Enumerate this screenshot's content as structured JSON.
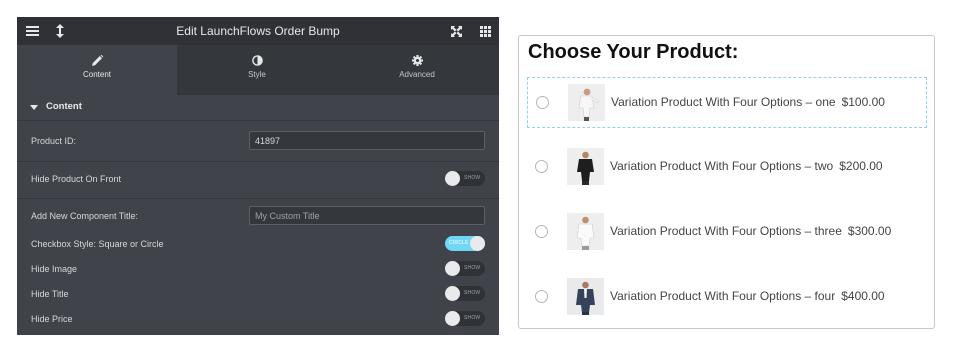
{
  "editor": {
    "title": "Edit LaunchFlows Order Bump",
    "tabs": [
      {
        "label": "Content",
        "icon": "pencil-icon",
        "active": true
      },
      {
        "label": "Style",
        "icon": "contrast-icon",
        "active": false
      },
      {
        "label": "Advanced",
        "icon": "gear-icon",
        "active": false
      }
    ],
    "section_title": "Content",
    "fields": {
      "product_id": {
        "label": "Product ID:",
        "value": "41897"
      },
      "hide_product_on_front": {
        "label": "Hide Product On Front",
        "toggle_text": "SHOW",
        "on": false
      },
      "add_new_component_title": {
        "label": "Add New Component Title:",
        "placeholder": "My Custom Title"
      },
      "checkbox_style": {
        "label": "Checkbox Style: Square or Circle",
        "toggle_text": "CIRCLE",
        "on": true
      },
      "hide_image": {
        "label": "Hide Image",
        "toggle_text": "SHOW",
        "on": false
      },
      "hide_title": {
        "label": "Hide Title",
        "toggle_text": "SHOW",
        "on": false
      },
      "hide_price": {
        "label": "Hide Price",
        "toggle_text": "SHOW",
        "on": false
      }
    },
    "colors": {
      "accent": "#71d7f7",
      "panel_bg": "#404349",
      "topbar_bg": "#303136"
    }
  },
  "preview": {
    "heading": "Choose Your Product:",
    "products": [
      {
        "name": "Variation Product With Four Options – one",
        "price": "$100.00",
        "selected": true
      },
      {
        "name": "Variation Product With Four Options – two",
        "price": "$200.00",
        "selected": false
      },
      {
        "name": "Variation Product With Four Options – three",
        "price": "$300.00",
        "selected": false
      },
      {
        "name": "Variation Product With Four Options – four",
        "price": "$400.00",
        "selected": false
      }
    ]
  }
}
